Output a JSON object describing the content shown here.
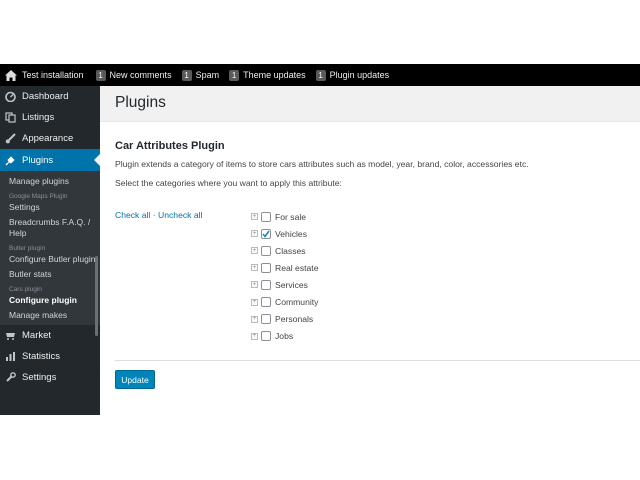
{
  "admin_bar": {
    "site_name": "Test installation",
    "items": [
      {
        "count": "1",
        "label": "New comments"
      },
      {
        "count": "1",
        "label": "Spam"
      },
      {
        "count": "1",
        "label": "Theme updates"
      },
      {
        "count": "1",
        "label": "Plugin updates"
      }
    ]
  },
  "sidebar": {
    "menu": {
      "dashboard": "Dashboard",
      "listings": "Listings",
      "appearance": "Appearance",
      "plugins": "Plugins",
      "market": "Market",
      "statistics": "Statistics",
      "settings": "Settings"
    },
    "submenu": {
      "manage_plugins": "Manage plugins",
      "google_maps_group": "Google Maps Plugin",
      "google_maps_settings": "Settings",
      "breadcrumbs_faq": "Breadcrumbs F.A.Q. / Help",
      "butler_group": "Butler plugin",
      "configure_butler": "Configure Butler plugin",
      "butler_stats": "Butler stats",
      "cars_group": "Cars plugin",
      "configure_plugin": "Configure plugin",
      "manage_makes": "Manage makes"
    }
  },
  "page": {
    "title": "Plugins",
    "plugin_heading": "Car Attributes Plugin",
    "description": "Plugin extends a category of items to store cars attributes such as model, year, brand, color, accessories etc.",
    "instruction": "Select the categories where you want to apply this attribute:",
    "check_all": "Check all",
    "separator": "·",
    "uncheck_all": "Uncheck all",
    "categories": [
      {
        "label": "For sale",
        "checked": false
      },
      {
        "label": "Vehicles",
        "checked": true
      },
      {
        "label": "Classes",
        "checked": false
      },
      {
        "label": "Real estate",
        "checked": false
      },
      {
        "label": "Services",
        "checked": false
      },
      {
        "label": "Community",
        "checked": false
      },
      {
        "label": "Personals",
        "checked": false
      },
      {
        "label": "Jobs",
        "checked": false
      }
    ],
    "expand_glyph": "+",
    "check_glyph": "✓",
    "update_button": "Update"
  },
  "colors": {
    "admin_bar": "#000000",
    "sidebar": "#23282d",
    "submenu": "#32373c",
    "accent": "#0073aa",
    "button": "#0085ba"
  }
}
